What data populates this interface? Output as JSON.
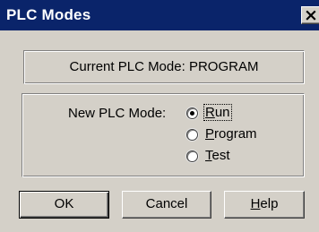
{
  "window": {
    "title": "PLC Modes",
    "close_glyph": "×"
  },
  "current": {
    "label": "Current PLC Mode:",
    "value": "PROGRAM"
  },
  "new_mode": {
    "label": "New PLC Mode:",
    "options": [
      {
        "key": "R",
        "rest": "un",
        "text": "Run",
        "selected": true
      },
      {
        "key": "P",
        "rest": "rogram",
        "text": "Program",
        "selected": false
      },
      {
        "key": "T",
        "rest": "est",
        "text": "Test",
        "selected": false
      }
    ]
  },
  "buttons": {
    "ok": "OK",
    "cancel": "Cancel",
    "help_key": "H",
    "help_rest": "elp"
  }
}
